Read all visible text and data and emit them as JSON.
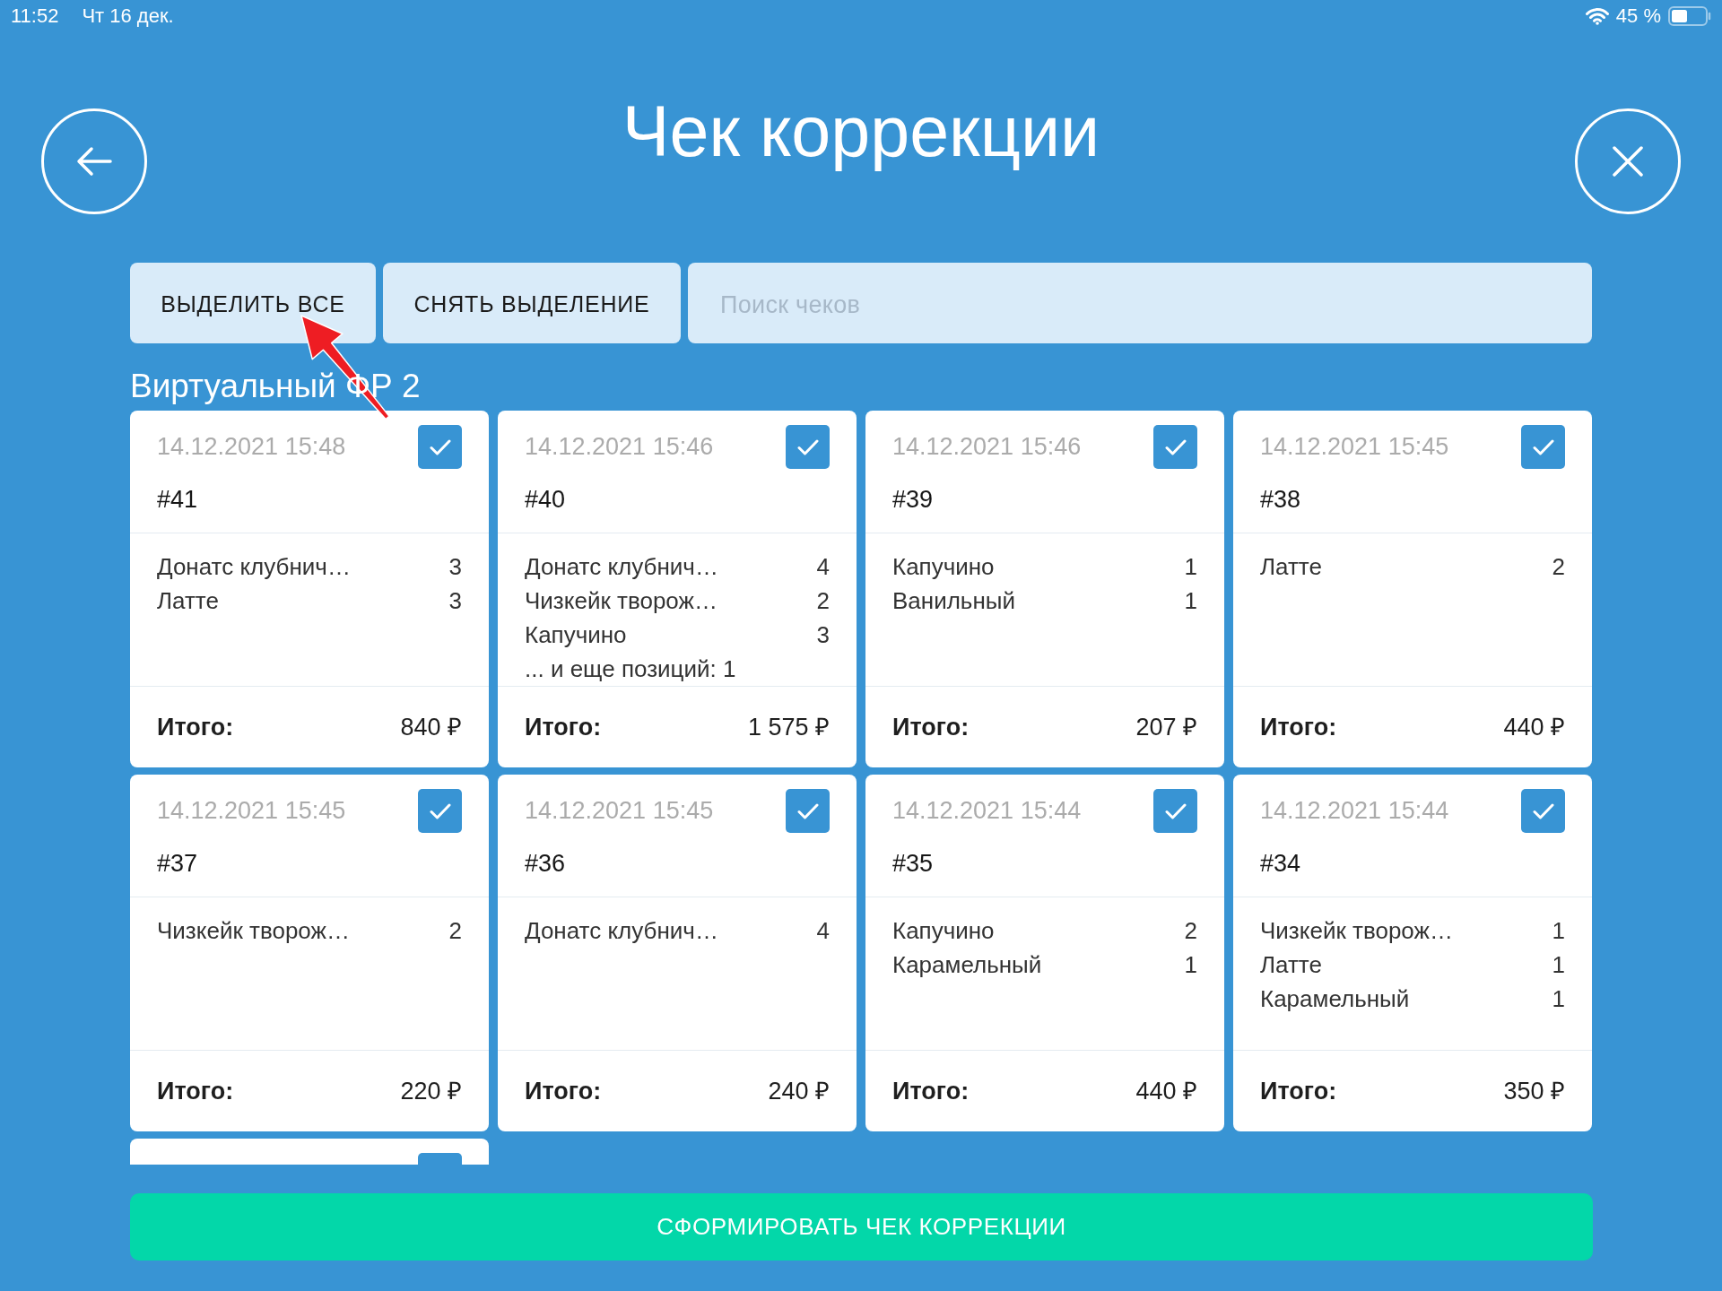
{
  "status_bar": {
    "time": "11:52",
    "date": "Чт 16 дек.",
    "battery": "45 %"
  },
  "title": "Чек коррекции",
  "toolbar": {
    "buttons": [
      {
        "label": "ВЫДЕЛИТЬ ВСЕ"
      },
      {
        "label": "СНЯТЬ ВЫДЕЛЕНИЕ"
      }
    ],
    "search": {
      "placeholder": "Поиск чеков"
    }
  },
  "section": {
    "title": "Виртуальный ФР 2",
    "receipts": [
      {
        "kind": "full",
        "datetime": "14.12.2021 15:48",
        "checked": true,
        "number": "#41",
        "items": [
          {
            "name": "Донатс клубнич…",
            "qty": "3"
          },
          {
            "name": "Латте",
            "qty": "3"
          }
        ],
        "total_label": "Итого:",
        "total": "840 ₽"
      },
      {
        "kind": "full",
        "datetime": "14.12.2021 15:46",
        "checked": true,
        "number": "#40",
        "items": [
          {
            "name": "Донатс клубнич…",
            "qty": "4"
          },
          {
            "name": "Чизкейк творож…",
            "qty": "2"
          },
          {
            "name": "Капучино",
            "qty": "3"
          }
        ],
        "more": "... и еще позиций: 1",
        "total_label": "Итого:",
        "total": "1 575 ₽"
      },
      {
        "kind": "full",
        "datetime": "14.12.2021 15:46",
        "checked": true,
        "number": "#39",
        "items": [
          {
            "name": "Капучино",
            "qty": "1"
          },
          {
            "name": "Ванильный",
            "qty": "1"
          }
        ],
        "total_label": "Итого:",
        "total": "207 ₽"
      },
      {
        "kind": "full",
        "datetime": "14.12.2021 15:45",
        "checked": true,
        "number": "#38",
        "items": [
          {
            "name": "Латте",
            "qty": "2"
          }
        ],
        "total_label": "Итого:",
        "total": "440 ₽"
      },
      {
        "kind": "full",
        "datetime": "14.12.2021 15:45",
        "checked": true,
        "number": "#37",
        "items": [
          {
            "name": "Чизкейк творож…",
            "qty": "2"
          }
        ],
        "total_label": "Итого:",
        "total": "220 ₽"
      },
      {
        "kind": "full",
        "datetime": "14.12.2021 15:45",
        "checked": true,
        "number": "#36",
        "items": [
          {
            "name": "Донатс клубнич…",
            "qty": "4"
          }
        ],
        "total_label": "Итого:",
        "total": "240 ₽"
      },
      {
        "kind": "full",
        "datetime": "14.12.2021 15:44",
        "checked": true,
        "number": "#35",
        "items": [
          {
            "name": "Капучино",
            "qty": "2"
          },
          {
            "name": "Карамельный",
            "qty": "1"
          }
        ],
        "total_label": "Итого:",
        "total": "440 ₽"
      },
      {
        "kind": "full",
        "datetime": "14.12.2021 15:44",
        "checked": true,
        "number": "#34",
        "items": [
          {
            "name": "Чизкейк творож…",
            "qty": "1"
          },
          {
            "name": "Латте",
            "qty": "1"
          },
          {
            "name": "Карамельный",
            "qty": "1"
          }
        ],
        "total_label": "Итого:",
        "total": "350 ₽"
      },
      {
        "kind": "clipped",
        "checked": true
      }
    ]
  },
  "submit_button": {
    "label": "СФОРМИРОВАТЬ ЧЕК КОРРЕКЦИИ"
  }
}
